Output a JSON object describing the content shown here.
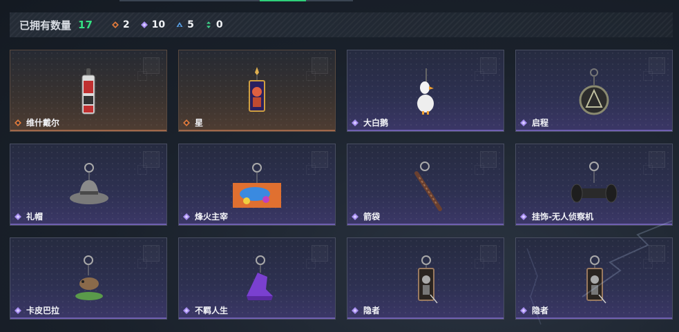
{
  "header": {
    "owned_label": "已拥有数量",
    "owned_count": "17",
    "stats": [
      {
        "icon": "orange-diamond-icon",
        "color": "#e07a3a",
        "value": "2"
      },
      {
        "icon": "purple-diamond-icon",
        "color": "#a68cf0",
        "value": "10"
      },
      {
        "icon": "blue-triangle-icon",
        "color": "#5aa0e6",
        "value": "5"
      },
      {
        "icon": "green-arrows-icon",
        "color": "#3ed48a",
        "value": "0"
      }
    ]
  },
  "items": [
    {
      "name": "维什戴尔",
      "rarity": "legendary",
      "art": "keychain-figure"
    },
    {
      "name": "星",
      "rarity": "legendary",
      "art": "tarot-card"
    },
    {
      "name": "大白鹅",
      "rarity": "epic",
      "art": "goose"
    },
    {
      "name": "启程",
      "rarity": "epic",
      "art": "medallion"
    },
    {
      "name": "礼帽",
      "rarity": "epic",
      "art": "hat"
    },
    {
      "name": "烽火主宰",
      "rarity": "epic",
      "art": "graffiti-plate"
    },
    {
      "name": "箭袋",
      "rarity": "epic",
      "art": "quiver"
    },
    {
      "name": "挂饰-无人侦察机",
      "rarity": "epic",
      "art": "drone"
    },
    {
      "name": "卡皮巴拉",
      "rarity": "epic",
      "art": "capybara"
    },
    {
      "name": "不羁人生",
      "rarity": "epic",
      "art": "sneaker"
    },
    {
      "name": "隐者",
      "rarity": "epic",
      "art": "hermit-card"
    },
    {
      "name": "隐者",
      "rarity": "epic",
      "art": "hermit-card"
    }
  ]
}
